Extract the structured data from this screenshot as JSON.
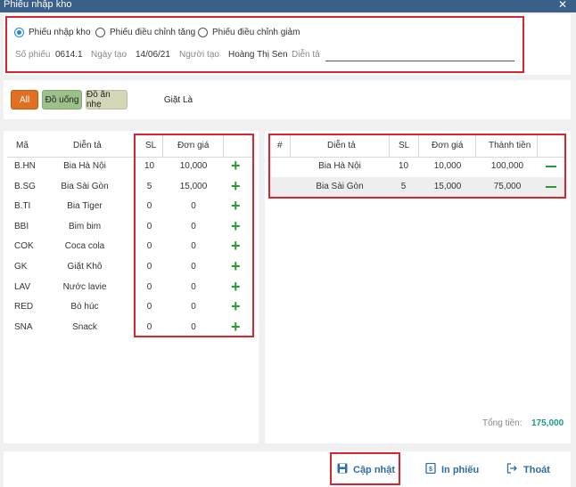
{
  "window": {
    "title": "Phiếu nhập kho",
    "close_glyph": "✕"
  },
  "type_options": [
    {
      "label": "Phiếu nhập kho",
      "checked": true
    },
    {
      "label": "Phiếu điều chỉnh tăng",
      "checked": false
    },
    {
      "label": "Phiếu điều chỉnh giảm",
      "checked": false
    }
  ],
  "info": {
    "so_phieu_label": "Số phiếu",
    "so_phieu": "0614.1",
    "ngay_tao_label": "Ngày tạo",
    "ngay_tao": "14/06/21",
    "nguoi_tao_label": "Người tạo",
    "nguoi_tao": "Hoàng Thị Sen",
    "dien_ta_label": "Diễn tả",
    "dien_ta": ""
  },
  "categories": [
    "All",
    "Đồ uống",
    "Đồ ăn nhẹ",
    "Giặt Là"
  ],
  "products": {
    "headers": {
      "ma": "Mã",
      "dien_ta": "Diễn tả",
      "sl": "SL",
      "don_gia": "Đơn giá"
    },
    "rows": [
      {
        "ma": "B.HN",
        "dien_ta": "Bia Hà Nội",
        "sl": "10",
        "don_gia": "10,000"
      },
      {
        "ma": "B.SG",
        "dien_ta": "Bia Sài Gòn",
        "sl": "5",
        "don_gia": "15,000"
      },
      {
        "ma": "B.TI",
        "dien_ta": "Bia Tiger",
        "sl": "0",
        "don_gia": "0"
      },
      {
        "ma": "BBI",
        "dien_ta": "Bim bim",
        "sl": "0",
        "don_gia": "0"
      },
      {
        "ma": "COK",
        "dien_ta": "Coca cola",
        "sl": "0",
        "don_gia": "0"
      },
      {
        "ma": "GK",
        "dien_ta": "Giặt Khô",
        "sl": "0",
        "don_gia": "0"
      },
      {
        "ma": "LAV",
        "dien_ta": "Nước lavie",
        "sl": "0",
        "don_gia": "0"
      },
      {
        "ma": "RED",
        "dien_ta": "Bò húc",
        "sl": "0",
        "don_gia": "0"
      },
      {
        "ma": "SNA",
        "dien_ta": "Snack",
        "sl": "0",
        "don_gia": "0"
      }
    ]
  },
  "selected": {
    "headers": {
      "idx": "#",
      "dien_ta": "Diễn tả",
      "sl": "SL",
      "don_gia": "Đơn giá",
      "thanh_tien": "Thành tiền"
    },
    "rows": [
      {
        "dien_ta": "Bia Hà Nội",
        "sl": "10",
        "don_gia": "10,000",
        "thanh_tien": "100,000"
      },
      {
        "dien_ta": "Bia Sài Gòn",
        "sl": "5",
        "don_gia": "15,000",
        "thanh_tien": "75,000"
      }
    ],
    "total_label": "Tổng tiền:",
    "total_value": "175,000"
  },
  "actions": {
    "update": "Cập nhật",
    "print": "In phiếu",
    "exit": "Thoát"
  },
  "colors": {
    "accent": "#2e6da4",
    "highlight_box": "#d9262d",
    "add": "#2a9a36",
    "total": "#1a9a8a"
  }
}
